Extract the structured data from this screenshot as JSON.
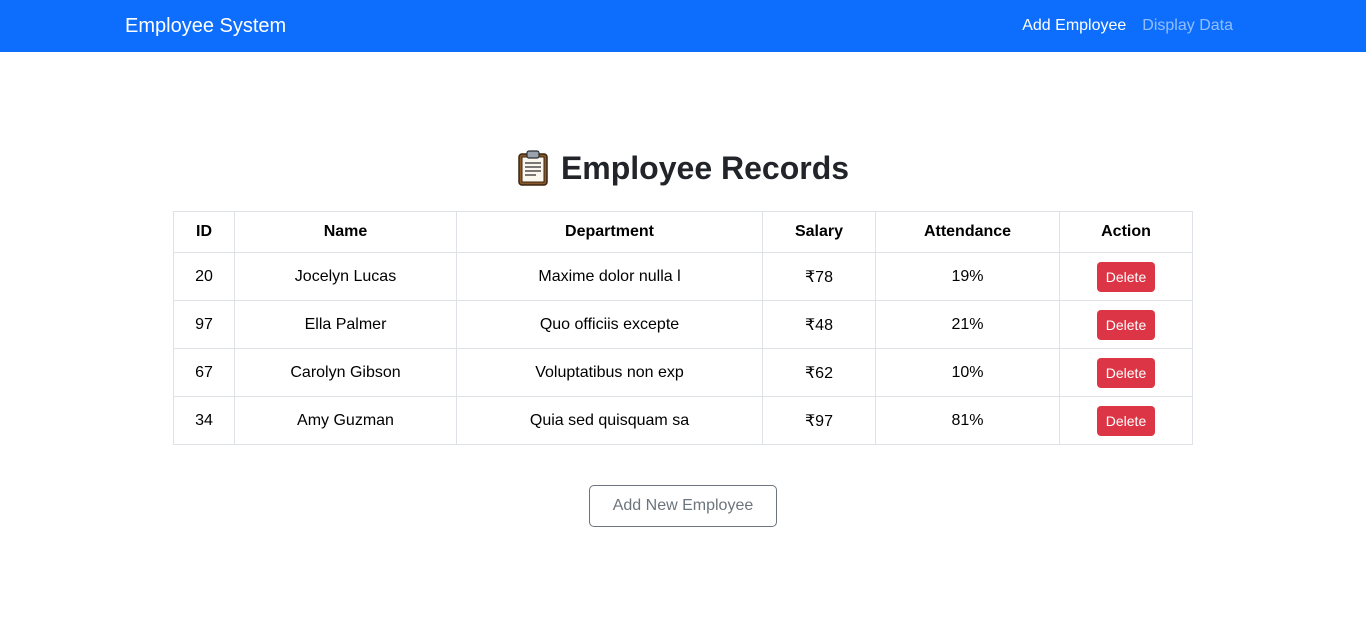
{
  "navbar": {
    "brand": "Employee System",
    "links": [
      {
        "label": "Add Employee"
      },
      {
        "label": "Display Data"
      }
    ]
  },
  "main": {
    "icon": "clipboard-icon",
    "title": "Employee Records",
    "table": {
      "headers": [
        "ID",
        "Name",
        "Department",
        "Salary",
        "Attendance",
        "Action"
      ],
      "rows": [
        {
          "id": "20",
          "name": "Jocelyn Lucas",
          "department": "Maxime dolor nulla l",
          "salary": "₹78",
          "attendance": "19%",
          "action": "Delete"
        },
        {
          "id": "97",
          "name": "Ella Palmer",
          "department": "Quo officiis excepte",
          "salary": "₹48",
          "attendance": "21%",
          "action": "Delete"
        },
        {
          "id": "67",
          "name": "Carolyn Gibson",
          "department": "Voluptatibus non exp",
          "salary": "₹62",
          "attendance": "10%",
          "action": "Delete"
        },
        {
          "id": "34",
          "name": "Amy Guzman",
          "department": "Quia sed quisquam sa",
          "salary": "₹97",
          "attendance": "81%",
          "action": "Delete"
        }
      ]
    },
    "add_button": "Add New Employee"
  },
  "colors": {
    "navbar": "#0d6efd",
    "delete": "#dc3545",
    "secondary": "#6c757d"
  }
}
